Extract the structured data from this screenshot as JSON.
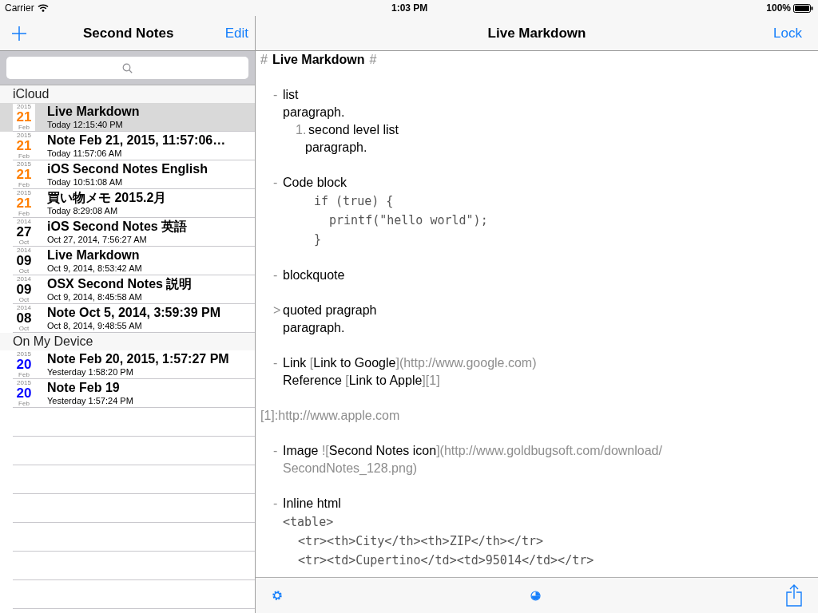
{
  "status_bar": {
    "carrier": "Carrier",
    "time": "1:03 PM",
    "battery": "100%"
  },
  "sidebar": {
    "title": "Second Notes",
    "edit": "Edit",
    "sections": [
      {
        "title": "iCloud",
        "notes": [
          {
            "year": "2015",
            "day": "21",
            "month": "Feb",
            "color": "#ff7f00",
            "title": "Live Markdown",
            "date": "Today 12:15:40 PM",
            "selected": true
          },
          {
            "year": "2015",
            "day": "21",
            "month": "Feb",
            "color": "#ff7f00",
            "title": "Note Feb 21, 2015, 11:57:06…",
            "date": "Today 11:57:06 AM",
            "selected": false
          },
          {
            "year": "2015",
            "day": "21",
            "month": "Feb",
            "color": "#ff7f00",
            "title": "iOS Second Notes English",
            "date": "Today 10:51:08 AM",
            "selected": false
          },
          {
            "year": "2015",
            "day": "21",
            "month": "Feb",
            "color": "#ff7f00",
            "title": "買い物メモ 2015.2月",
            "date": "Today 8:29:08 AM",
            "selected": false
          },
          {
            "year": "2014",
            "day": "27",
            "month": "Oct",
            "color": "#000000",
            "title": "iOS Second Notes 英語",
            "date": "Oct 27, 2014, 7:56:27 AM",
            "selected": false
          },
          {
            "year": "2014",
            "day": "09",
            "month": "Oct",
            "color": "#000000",
            "title": "Live Markdown",
            "date": "Oct 9, 2014, 8:53:42 AM",
            "selected": false
          },
          {
            "year": "2014",
            "day": "09",
            "month": "Oct",
            "color": "#000000",
            "title": "OSX Second Notes 説明",
            "date": "Oct 9, 2014, 8:45:58 AM",
            "selected": false
          },
          {
            "year": "2014",
            "day": "08",
            "month": "Oct",
            "color": "#000000",
            "title": "Note Oct 5, 2014, 3:59:39 PM",
            "date": "Oct 8, 2014, 9:48:55 AM",
            "selected": false
          }
        ]
      },
      {
        "title": "On My Device",
        "notes": [
          {
            "year": "2015",
            "day": "20",
            "month": "Feb",
            "color": "#0000ff",
            "title": "Note Feb 20, 2015, 1:57:27 PM",
            "date": "Yesterday 1:58:20 PM",
            "selected": false
          },
          {
            "year": "2015",
            "day": "20",
            "month": "Feb",
            "color": "#0000ff",
            "title": "Note Feb 19",
            "date": "Yesterday 1:57:24 PM",
            "selected": false
          }
        ]
      }
    ]
  },
  "editor": {
    "title": "Live Markdown",
    "lock": "Lock",
    "lines": [
      {
        "kind": "heading",
        "segments": [
          {
            "kind": "mark",
            "text": "#"
          },
          {
            "kind": "bold",
            "text": "Live Markdown"
          },
          {
            "kind": "mark",
            "text": "#"
          }
        ]
      },
      {
        "kind": "blank"
      },
      {
        "kind": "item",
        "marker": "-",
        "segments": [
          {
            "kind": "text",
            "text": "list"
          }
        ]
      },
      {
        "kind": "cont",
        "segments": [
          {
            "kind": "text",
            "text": "paragraph."
          }
        ]
      },
      {
        "kind": "subitem",
        "marker": "1.",
        "segments": [
          {
            "kind": "text",
            "text": "second level list"
          }
        ]
      },
      {
        "kind": "subcont",
        "segments": [
          {
            "kind": "text",
            "text": "paragraph."
          }
        ]
      },
      {
        "kind": "blank"
      },
      {
        "kind": "item",
        "marker": "-",
        "segments": [
          {
            "kind": "text",
            "text": "Code block"
          }
        ]
      },
      {
        "kind": "code",
        "segments": [
          {
            "kind": "code",
            "text": "if (true) {"
          }
        ]
      },
      {
        "kind": "code2",
        "segments": [
          {
            "kind": "code",
            "text": "printf(\"hello world\");"
          }
        ]
      },
      {
        "kind": "code",
        "segments": [
          {
            "kind": "code",
            "text": "}"
          }
        ]
      },
      {
        "kind": "blank"
      },
      {
        "kind": "item",
        "marker": "-",
        "segments": [
          {
            "kind": "text",
            "text": "blockquote"
          }
        ]
      },
      {
        "kind": "blank"
      },
      {
        "kind": "item",
        "marker": ">",
        "segments": [
          {
            "kind": "text",
            "text": "quoted pragraph"
          }
        ]
      },
      {
        "kind": "cont",
        "segments": [
          {
            "kind": "text",
            "text": "paragraph."
          }
        ]
      },
      {
        "kind": "blank"
      },
      {
        "kind": "item",
        "marker": "-",
        "segments": [
          {
            "kind": "text",
            "text": "Link "
          },
          {
            "kind": "mark",
            "text": "["
          },
          {
            "kind": "text",
            "text": "Link to Google"
          },
          {
            "kind": "mark",
            "text": "](http://www.google.com)"
          }
        ]
      },
      {
        "kind": "cont",
        "segments": [
          {
            "kind": "text",
            "text": "Reference "
          },
          {
            "kind": "mark",
            "text": "["
          },
          {
            "kind": "text",
            "text": "Link to Apple"
          },
          {
            "kind": "mark",
            "text": "][1]"
          }
        ]
      },
      {
        "kind": "blank"
      },
      {
        "kind": "ref",
        "segments": [
          {
            "kind": "mark",
            "text": "[1]:http://www.apple.com"
          }
        ]
      },
      {
        "kind": "blank"
      },
      {
        "kind": "item",
        "marker": "-",
        "segments": [
          {
            "kind": "text",
            "text": "Image "
          },
          {
            "kind": "mark",
            "text": "!["
          },
          {
            "kind": "text",
            "text": "Second Notes icon"
          },
          {
            "kind": "mark",
            "text": "](http://www.goldbugsoft.com/download/"
          }
        ]
      },
      {
        "kind": "cont",
        "segments": [
          {
            "kind": "mark",
            "text": "SecondNotes_128.png)"
          }
        ]
      },
      {
        "kind": "blank"
      },
      {
        "kind": "item",
        "marker": "-",
        "segments": [
          {
            "kind": "text",
            "text": "Inline html"
          }
        ]
      },
      {
        "kind": "html",
        "segments": [
          {
            "kind": "code",
            "text": "<table>"
          }
        ]
      },
      {
        "kind": "html2",
        "segments": [
          {
            "kind": "code",
            "text": "<tr><th>City</th><th>ZIP</th></tr>"
          }
        ]
      },
      {
        "kind": "html2",
        "segments": [
          {
            "kind": "code",
            "text": "<tr><td>Cupertino</td><td>95014</td></tr>"
          }
        ]
      }
    ]
  }
}
